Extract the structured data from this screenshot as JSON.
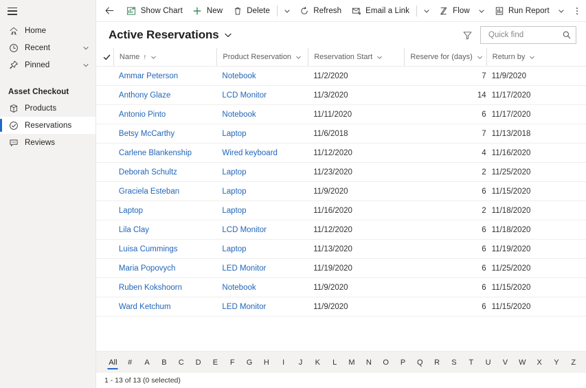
{
  "sidebar": {
    "hamburger": "site-map-hamburger",
    "nav": [
      {
        "label": "Home",
        "icon": "home-icon",
        "chevron": false
      },
      {
        "label": "Recent",
        "icon": "clock-icon",
        "chevron": true
      },
      {
        "label": "Pinned",
        "icon": "pin-icon",
        "chevron": true
      }
    ],
    "group_title": "Asset Checkout",
    "group_items": [
      {
        "label": "Products",
        "icon": "box-icon",
        "active": false
      },
      {
        "label": "Reservations",
        "icon": "checkmark-circle-icon",
        "active": true
      },
      {
        "label": "Reviews",
        "icon": "comment-icon",
        "active": false
      }
    ]
  },
  "commandbar": {
    "back": "back-arrow-icon",
    "items": [
      {
        "label": "Show Chart",
        "icon": "chart-icon",
        "caret": false
      },
      {
        "label": "New",
        "icon": "plus-icon",
        "caret": false
      },
      {
        "label": "Delete",
        "icon": "trash-icon",
        "caret": true,
        "sep_before": false,
        "sep_after": true
      },
      {
        "label": "Refresh",
        "icon": "refresh-icon",
        "caret": false
      },
      {
        "label": "Email a Link",
        "icon": "email-icon",
        "caret": true,
        "sep_after": true
      },
      {
        "label": "Flow",
        "icon": "flow-icon",
        "caret": true
      },
      {
        "label": "Run Report",
        "icon": "report-icon",
        "caret": true
      }
    ],
    "overflow": "more-options-ellipsis"
  },
  "view": {
    "title": "Active Reservations",
    "title_chevron": "chevron-down-icon",
    "filter_icon": "filter-icon",
    "search": {
      "placeholder": "Quick find",
      "value": "",
      "icon": "search-icon"
    }
  },
  "grid": {
    "columns": [
      {
        "label": "Name",
        "sorted": true,
        "sort_arrow": "↑",
        "align": "left"
      },
      {
        "label": "Product Reservation",
        "sorted": false,
        "align": "left"
      },
      {
        "label": "Reservation Start",
        "sorted": false,
        "align": "left"
      },
      {
        "label": "Reserve for (days)",
        "sorted": false,
        "align": "right"
      },
      {
        "label": "Return by",
        "sorted": false,
        "align": "left"
      }
    ],
    "rows": [
      {
        "name": "Ammar Peterson",
        "product": "Notebook",
        "start": "11/2/2020",
        "days": "7",
        "return": "11/9/2020"
      },
      {
        "name": "Anthony Glaze",
        "product": "LCD Monitor",
        "start": "11/3/2020",
        "days": "14",
        "return": "11/17/2020"
      },
      {
        "name": "Antonio Pinto",
        "product": "Notebook",
        "start": "11/11/2020",
        "days": "6",
        "return": "11/17/2020"
      },
      {
        "name": "Betsy McCarthy",
        "product": "Laptop",
        "start": "11/6/2018",
        "days": "7",
        "return": "11/13/2018"
      },
      {
        "name": "Carlene Blankenship",
        "product": "Wired keyboard",
        "start": "11/12/2020",
        "days": "4",
        "return": "11/16/2020"
      },
      {
        "name": "Deborah Schultz",
        "product": "Laptop",
        "start": "11/23/2020",
        "days": "2",
        "return": "11/25/2020"
      },
      {
        "name": "Graciela Esteban",
        "product": "Laptop",
        "start": "11/9/2020",
        "days": "6",
        "return": "11/15/2020"
      },
      {
        "name": "Laptop",
        "product": "Laptop",
        "start": "11/16/2020",
        "days": "2",
        "return": "11/18/2020"
      },
      {
        "name": "Lila Clay",
        "product": "LCD Monitor",
        "start": "11/12/2020",
        "days": "6",
        "return": "11/18/2020"
      },
      {
        "name": "Luisa Cummings",
        "product": "Laptop",
        "start": "11/13/2020",
        "days": "6",
        "return": "11/19/2020"
      },
      {
        "name": "Maria Popovych",
        "product": "LED Monitor",
        "start": "11/19/2020",
        "days": "6",
        "return": "11/25/2020"
      },
      {
        "name": "Ruben Kokshoorn",
        "product": "Notebook",
        "start": "11/9/2020",
        "days": "6",
        "return": "11/15/2020"
      },
      {
        "name": "Ward Ketchum",
        "product": "LED Monitor",
        "start": "11/9/2020",
        "days": "6",
        "return": "11/15/2020"
      }
    ]
  },
  "footer": {
    "alpha_index": [
      "All",
      "#",
      "A",
      "B",
      "C",
      "D",
      "E",
      "F",
      "G",
      "H",
      "I",
      "J",
      "K",
      "L",
      "M",
      "N",
      "O",
      "P",
      "Q",
      "R",
      "S",
      "T",
      "U",
      "V",
      "W",
      "X",
      "Y",
      "Z"
    ],
    "active_alpha": "All",
    "status": "1 - 13 of 13 (0 selected)"
  },
  "colors": {
    "accent": "#2266cc",
    "link": "#2266b8",
    "sidebar_bg": "#f3f2f1",
    "text": "#201f1e",
    "muted": "#605e5c",
    "new_green": "#107c41"
  }
}
